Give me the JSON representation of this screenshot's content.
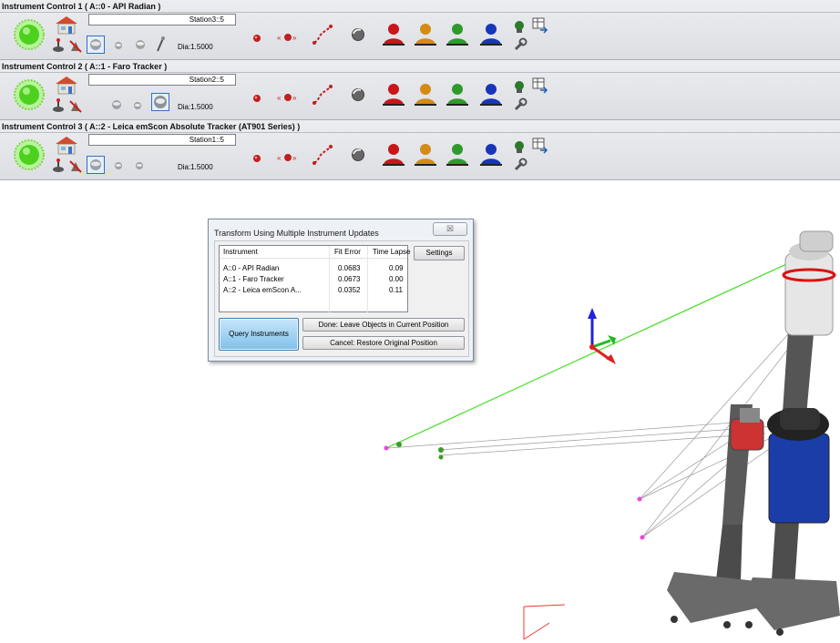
{
  "instrument_panels": [
    {
      "title": "Instrument Control 1 ( A::0 - API Radian )",
      "station": "Station3::5",
      "dia": "Dia:1.5000"
    },
    {
      "title": "Instrument Control 2 ( A::1 - Faro Tracker )",
      "station": "Station2::5",
      "dia": "Dia:1.5000"
    },
    {
      "title": "Instrument Control 3 ( A::2 - Leica emScon Absolute Tracker (AT901 Series) )",
      "station": "Station1::5",
      "dia": "Dia:1.5000"
    }
  ],
  "dialog": {
    "title": "Transform Using Multiple Instrument Updates",
    "close_label": "☒",
    "columns": [
      "Instrument",
      "Fit Error",
      "Time Lapse"
    ],
    "rows": [
      {
        "instrument": "A::0 - API Radian",
        "fit_error": "0.0683",
        "time_lapse": "0.09"
      },
      {
        "instrument": "A::1 - Faro Tracker",
        "fit_error": "0.0673",
        "time_lapse": "0.00"
      },
      {
        "instrument": "A::2 - Leica emScon A...",
        "fit_error": "0.0352",
        "time_lapse": "0.11"
      }
    ],
    "settings_label": "Settings",
    "query_label": "Query Instruments",
    "done_label": "Done: Leave Objects in Current Position",
    "cancel_label": "Cancel: Restore Original Position"
  },
  "colors": {
    "status_green": "#4cd11f",
    "person_red": "#c8161b",
    "person_orange": "#d48b14",
    "person_green": "#2f9a2a",
    "person_blue": "#1736b8",
    "measurement_line": "#44dd22",
    "panel_bg": "#e3e5e9"
  },
  "icons": [
    "status-light-icon",
    "home-icon",
    "joystick-icon",
    "clear-icon",
    "sphere-target-icon",
    "small-target-icon",
    "probe-icon",
    "red-target-icon",
    "nest-target-icon",
    "point-path-icon",
    "shiny-ball-icon",
    "red-person-icon",
    "orange-person-icon",
    "green-person-icon",
    "blue-person-icon",
    "camera-icon",
    "export-grid-icon",
    "wrench-icon"
  ]
}
